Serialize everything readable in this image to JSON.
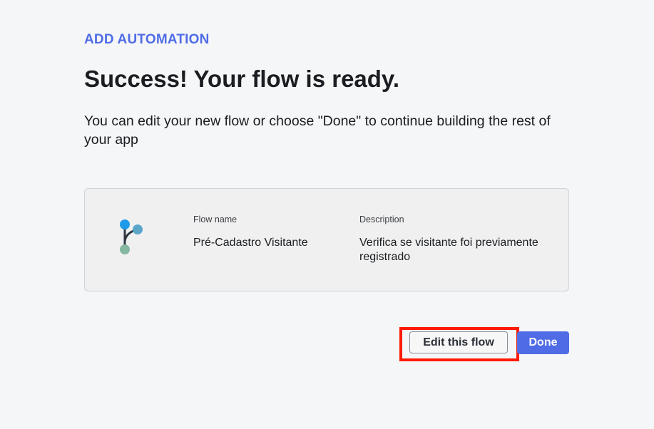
{
  "header": {
    "eyebrow": "ADD AUTOMATION",
    "title": "Success! Your flow is ready.",
    "subtitle": "You can edit your new flow or choose \"Done\" to continue building the rest of your app"
  },
  "flow_card": {
    "icon": "flow-branch-icon",
    "name_label": "Flow name",
    "name_value": "Pré-Cadastro Visitante",
    "description_label": "Description",
    "description_value": "Verifica se visitante foi previamente registrado"
  },
  "actions": {
    "edit_label": "Edit this flow",
    "done_label": "Done"
  },
  "colors": {
    "accent": "#4f6ce6",
    "highlight": "#ff1a00",
    "background": "#f5f6f8",
    "card_background": "#f0f0f0",
    "icon_blue": "#1e9be9",
    "icon_light_blue": "#5aa6c9",
    "icon_green": "#86b7a0",
    "icon_stem": "#2f3640"
  }
}
